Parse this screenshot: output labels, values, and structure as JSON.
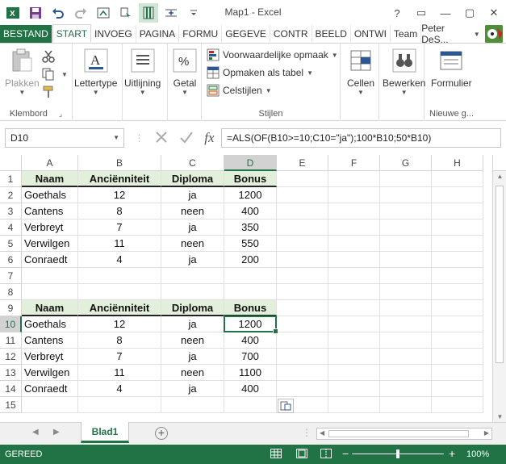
{
  "app": {
    "title": "Map1 - Excel",
    "icon": "excel-logo-icon"
  },
  "quick_access": [
    "save-icon",
    "undo-icon",
    "redo-icon",
    "screenshot-icon",
    "macro-icon",
    "freeze-icon",
    "distribute-icon",
    "customize-icon"
  ],
  "window_buttons": [
    "?",
    "▭",
    "—",
    "▢",
    "✕"
  ],
  "tabs": [
    "BESTAND",
    "START",
    "INVOEG",
    "PAGINA",
    "FORMU",
    "GEGEVE",
    "CONTR",
    "BEELD",
    "ONTWI",
    "Team"
  ],
  "active_tab": "START",
  "user": {
    "name": "Peter DeS..."
  },
  "ribbon": {
    "clipboard": {
      "paste_label": "Plakken",
      "group_label": "Klembord"
    },
    "font": {
      "label": "Lettertype"
    },
    "alignment": {
      "label": "Uitlijning"
    },
    "number": {
      "label": "Getal"
    },
    "styles": {
      "conditional": "Voorwaardelijke opmaak",
      "as_table": "Opmaken als tabel",
      "cell_styles": "Celstijlen",
      "group_label": "Stijlen"
    },
    "cells": {
      "label": "Cellen"
    },
    "editing": {
      "label": "Bewerken"
    },
    "form": {
      "label": "Formulier",
      "group_label": "Nieuwe g..."
    }
  },
  "formula_bar": {
    "name_box": "D10",
    "cancel_icon": "cancel-icon",
    "enter_icon": "enter-icon",
    "fx_label": "fx",
    "formula": "=ALS(OF(B10>=10;C10=\"ja\");100*B10;50*B10)"
  },
  "columns": [
    "A",
    "B",
    "C",
    "D",
    "E",
    "F",
    "G",
    "H"
  ],
  "selected_column": "D",
  "rows": [
    "1",
    "2",
    "3",
    "4",
    "5",
    "6",
    "7",
    "8",
    "9",
    "10",
    "11",
    "12",
    "13",
    "14",
    "15"
  ],
  "selected_row": "10",
  "table1": {
    "headers": [
      "Naam",
      "Anciënniteit",
      "Diploma",
      "Bonus"
    ],
    "rows": [
      [
        "Goethals",
        "12",
        "ja",
        "1200"
      ],
      [
        "Cantens",
        "8",
        "neen",
        "400"
      ],
      [
        "Verbreyt",
        "7",
        "ja",
        "350"
      ],
      [
        "Verwilgen",
        "11",
        "neen",
        "550"
      ],
      [
        "Conraedt",
        "4",
        "ja",
        "200"
      ]
    ]
  },
  "table2": {
    "headers": [
      "Naam",
      "Anciënniteit",
      "Diploma",
      "Bonus"
    ],
    "rows": [
      [
        "Goethals",
        "12",
        "ja",
        "1200"
      ],
      [
        "Cantens",
        "8",
        "neen",
        "400"
      ],
      [
        "Verbreyt",
        "7",
        "ja",
        "700"
      ],
      [
        "Verwilgen",
        "11",
        "neen",
        "1100"
      ],
      [
        "Conraedt",
        "4",
        "ja",
        "400"
      ]
    ]
  },
  "sheet": {
    "name": "Blad1",
    "add_icon": "add-sheet-icon"
  },
  "status": {
    "text": "GEREED",
    "zoom": "100%",
    "zoom_level": 0.5
  },
  "colors": {
    "accent": "#217346",
    "header_fill": "#e2efda"
  }
}
